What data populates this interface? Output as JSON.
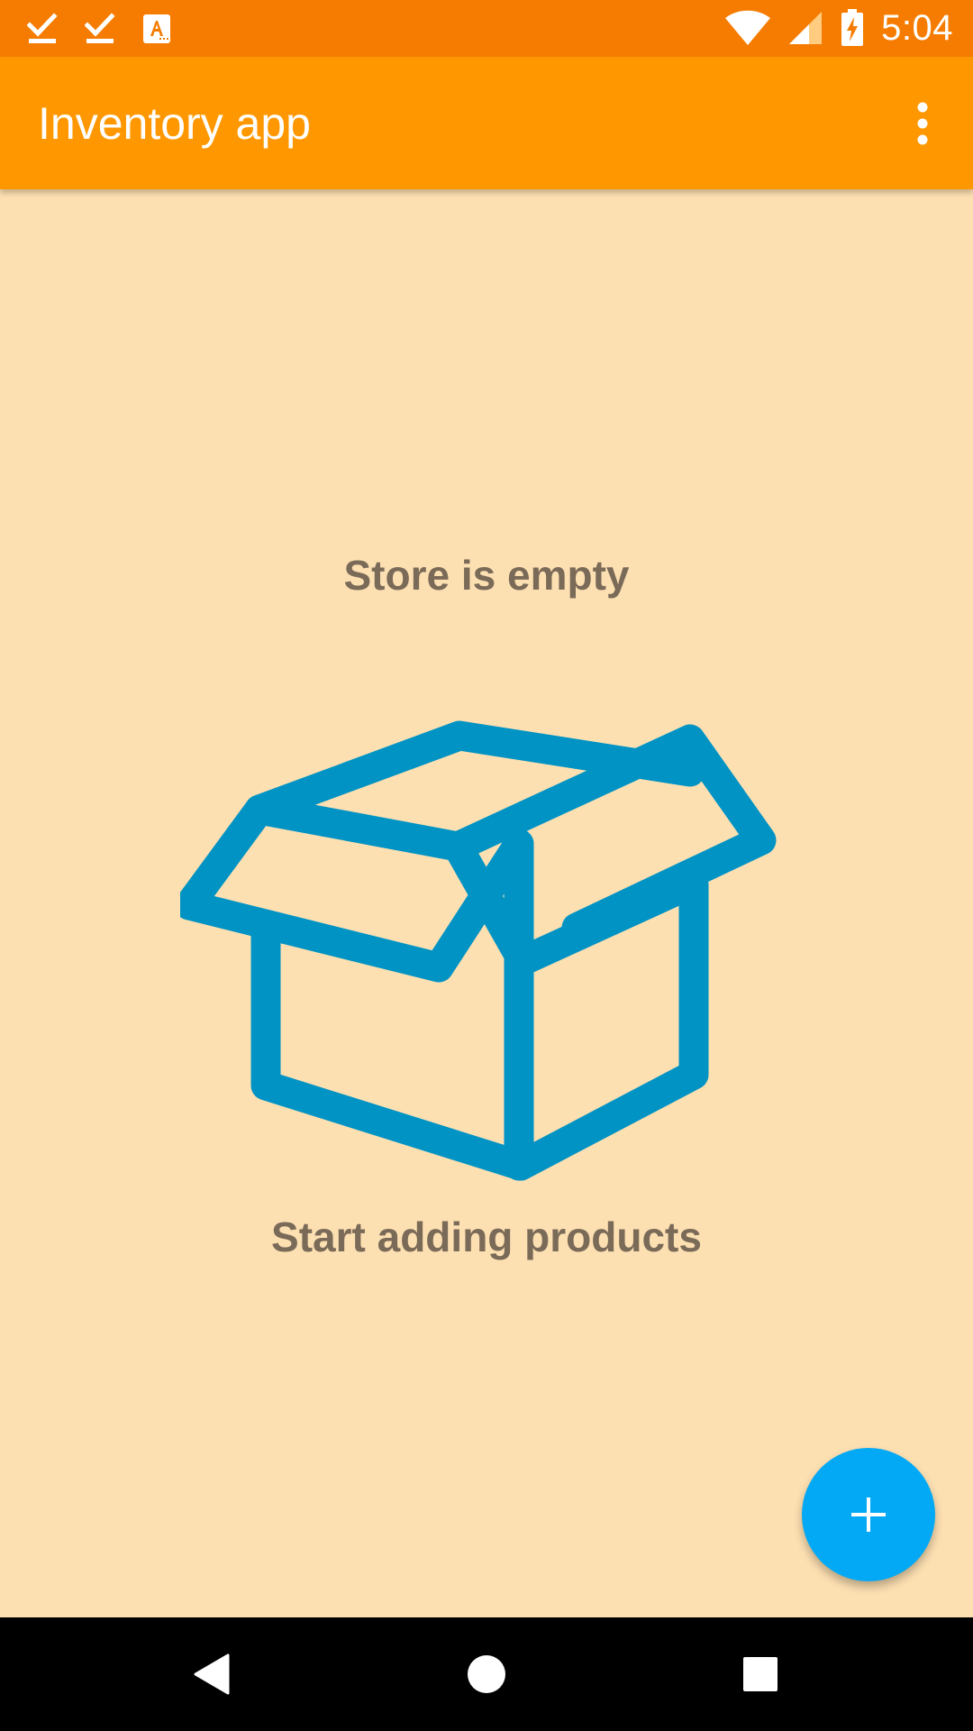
{
  "status_bar": {
    "time": "5:04",
    "notification_icons": [
      "download-done-icon",
      "download-done-icon",
      "text-recognition-icon"
    ],
    "system_icons": [
      "wifi-icon",
      "cell-signal-icon",
      "battery-charging-icon"
    ],
    "background_color": "#F57C00"
  },
  "app_bar": {
    "title": "Inventory app",
    "overflow_icon": "more-vert-icon",
    "background_color": "#FF9800"
  },
  "empty_state": {
    "title": "Store is empty",
    "illustration": "open-box-icon",
    "illustration_color": "#0093C4",
    "subtitle": "Start adding products",
    "background_color": "#FDE0B2"
  },
  "fab": {
    "icon": "add-icon",
    "background_color": "#03A9F4"
  },
  "navigation_bar": {
    "buttons": [
      "back-icon",
      "home-icon",
      "recents-icon"
    ]
  }
}
